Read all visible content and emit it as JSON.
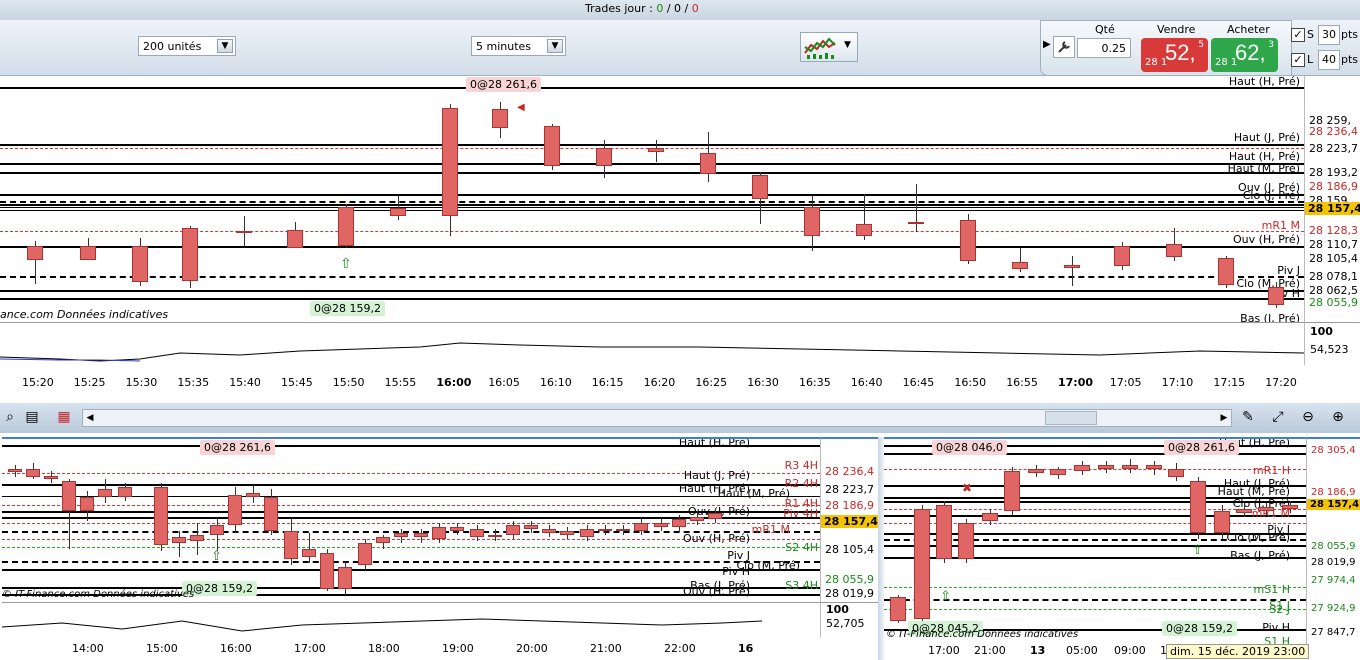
{
  "topbar": {
    "trades_label": "Trades jour : ",
    "trades_a": "0",
    "trades_sep1": " / ",
    "trades_b": "0",
    "trades_sep2": " / ",
    "trades_c": "0"
  },
  "toolbar": {
    "units_value": "200 unités",
    "interval_value": "5 minutes"
  },
  "trade_panel": {
    "qty_label": "Qté",
    "qty_value": "0.25",
    "sell_label": "Vendre",
    "sell_prefix": "28 1",
    "sell_big": "52,",
    "sell_sup": "5",
    "buy_label": "Acheter",
    "buy_prefix": "28 1",
    "buy_big": "62,",
    "buy_sup": "3",
    "s_label": "S",
    "s_pts": "30",
    "l_label": "L",
    "l_pts": "40",
    "pts_label": "pts"
  },
  "colors": {
    "up": "#4cc94c",
    "down": "#e06666",
    "current_price": "#f5c400"
  },
  "main_chart": {
    "top_tag": "0@28 261,6",
    "bottom_tag": "0@28 159,2",
    "watermark": "ance.com  Données indicatives",
    "line_labels": [
      "Haut (H, Pré)",
      "Haut (J, Pré)",
      "Haut (H, Pré)",
      "Haut (M, Pré)",
      "Ouv (J, Pré)",
      "Clo (J, Pré)",
      "mR1 M",
      "Ouv (H, Pré)",
      "Piv J",
      "Clo (M, Pré)",
      "Piv H",
      "Bas (J, Pré)"
    ],
    "price_labels": [
      "28 259,",
      "28 236,4",
      "28 223,7",
      "28 193,2",
      "28 186,9",
      "28 159,",
      "28 157,4",
      "28 128,3",
      "28 110,7",
      "28 105,4",
      "28 078,1",
      "28 062,5",
      "28 055,9"
    ],
    "osc_top": "100",
    "osc_value": "54,523",
    "time_labels": [
      "15:20",
      "15:25",
      "15:30",
      "15:35",
      "15:40",
      "15:45",
      "15:50",
      "15:55",
      "16:00",
      "16:05",
      "16:10",
      "16:15",
      "16:20",
      "16:25",
      "16:30",
      "16:35",
      "16:40",
      "16:45",
      "16:50",
      "16:55",
      "17:00",
      "17:05",
      "17:10",
      "17:15",
      "17:20"
    ]
  },
  "left_chart": {
    "top_tag": "0@28 261,6",
    "bottom_tag": "0@28 159,2",
    "watermark": "© IT-Finance.com  Données indicatives",
    "right_labels": [
      "Haut (H, Pré)",
      "R3 4H",
      "Haut (J, Pré)",
      "R2 4H",
      "Haut (H, Pré)",
      "Haut (M, Pré)",
      "R1 4H",
      "Piv 4H",
      "Ouv (J, Pré)",
      "mR1 M",
      "Ouv (H, Pré)",
      "S2 4H",
      "Piv J",
      "Clo (M, Pré)",
      "Piv H",
      "S3 4H",
      "Bas (J, Pré)",
      "Ouv (H, Pré)"
    ],
    "price_labels": [
      "28 236,4",
      "28 223,7",
      "28 186,9",
      "28 157,4",
      "28 105,4",
      "28 055,9",
      "28 019,9"
    ],
    "osc_top": "100",
    "osc_value": "52,705",
    "time_labels": [
      "14:00",
      "15:00",
      "16:00",
      "17:00",
      "18:00",
      "19:00",
      "20:00",
      "21:00",
      "22:00",
      "16"
    ]
  },
  "right_chart": {
    "top_tag_left": "0@28 046,0",
    "top_tag_right": "0@28 261,6",
    "bottom_tag_left": "0@28 045,2",
    "bottom_tag_right": "0@28 159,2",
    "watermark": "© IT-Finance.com  Données indicatives",
    "right_labels": [
      "Haut (H, Pré)",
      "mR1 H",
      "Haut (J, Pré)",
      "Haut (M, Pré)",
      "Clo (J, Pré)",
      "mR1 M",
      "Piv J",
      "Clo (M, Pré)",
      "Bas (J, Pré)",
      "mS1 H",
      "S1 J",
      "S2 J",
      "Piv H",
      "S1 H"
    ],
    "price_labels": [
      "28 305,4",
      "28 186,9",
      "28 157,4",
      "28 055,9",
      "28 019,9",
      "27 974,4",
      "27 924,9",
      "27 847,7"
    ],
    "time_labels": [
      "17:00",
      "21:00",
      "13",
      "05:00",
      "09:00",
      "1"
    ],
    "date_tooltip": "dim. 15 déc. 2019 23:00"
  }
}
